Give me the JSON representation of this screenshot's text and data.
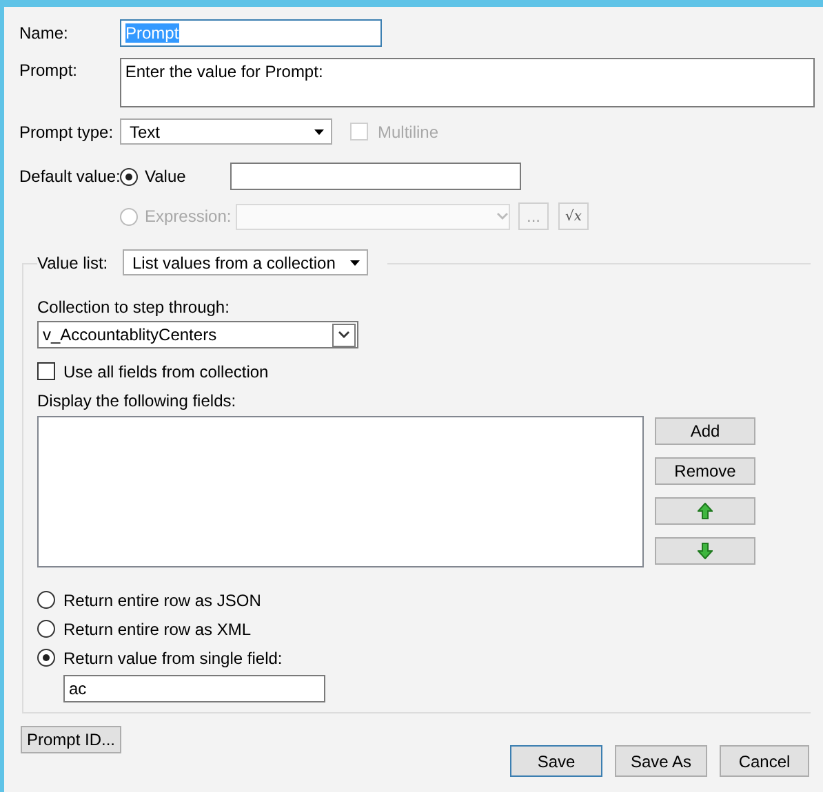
{
  "name": {
    "label": "Name:",
    "value": "Prompt",
    "text_selected": true
  },
  "prompt": {
    "label": "Prompt:",
    "value": "Enter the value for Prompt:"
  },
  "prompt_type": {
    "label": "Prompt type:",
    "value": "Text",
    "multiline": {
      "label": "Multiline",
      "checked": false,
      "disabled": true
    }
  },
  "default_value": {
    "label": "Default value:",
    "options": [
      {
        "kind": "text",
        "label": "Value",
        "selected": true,
        "disabled": false
      },
      {
        "kind": "expression",
        "label": "Expression:",
        "selected": false,
        "disabled": true,
        "browse_button": "...",
        "formula_button": "√x"
      }
    ]
  },
  "value_list": {
    "label": "Value list:",
    "value": "List values from a collection",
    "collection_label": "Collection to step through:",
    "collection": "v_AccountablityCenters",
    "use_all_fields": {
      "label": "Use all fields from collection",
      "checked": false
    },
    "fields_label": "Display the following fields:",
    "field_buttons": [
      {
        "kind": "text",
        "label": "Add"
      },
      {
        "kind": "text",
        "label": "Remove"
      },
      {
        "kind": "up"
      },
      {
        "kind": "down"
      }
    ],
    "return_options": [
      {
        "label": "Return entire row as JSON",
        "selected": false
      },
      {
        "label": "Return entire row as XML",
        "selected": false
      },
      {
        "label": "Return value from single field:",
        "selected": true
      }
    ],
    "single_field": "ac"
  },
  "prompt_id_button": "Prompt ID...",
  "buttons": [
    {
      "label": "Save",
      "default": true
    },
    {
      "label": "Save As",
      "default": false
    },
    {
      "label": "Cancel",
      "default": false
    }
  ]
}
